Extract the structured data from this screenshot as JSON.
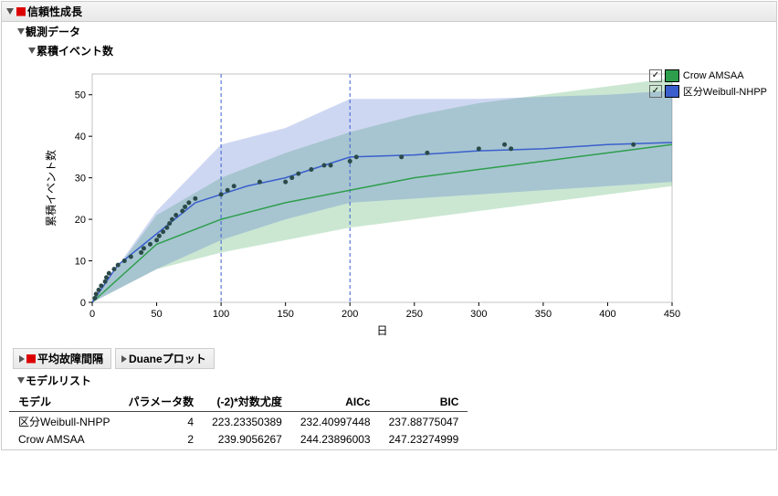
{
  "headers": {
    "main": "信頼性成長",
    "obs": "観測データ",
    "cum": "累積イベント数",
    "mtbf": "平均故障間隔",
    "duane": "Duaneプロット",
    "modellist": "モデルリスト"
  },
  "axis": {
    "x": "日",
    "y": "累積イベント数"
  },
  "legend": [
    {
      "label": "Crow AMSAA",
      "color": "#2e9e4d"
    },
    {
      "label": "区分Weibull-NHPP",
      "color": "#3a5fcd"
    }
  ],
  "model_table": {
    "cols": [
      "モデル",
      "パラメータ数",
      "(-2)*対数尤度",
      "AICc",
      "BIC"
    ],
    "rows": [
      [
        "区分Weibull-NHPP",
        "4",
        "223.23350389",
        "232.40997448",
        "237.88775047"
      ],
      [
        "Crow AMSAA",
        "2",
        "239.9056267",
        "244.23896003",
        "247.23274999"
      ]
    ]
  },
  "chart_data": {
    "type": "scatter+line+band",
    "title": "累積イベント数",
    "xlabel": "日",
    "ylabel": "累積イベント数",
    "xlim": [
      0,
      450
    ],
    "ylim": [
      0,
      55
    ],
    "xticks": [
      0,
      50,
      100,
      150,
      200,
      250,
      300,
      350,
      400,
      450
    ],
    "yticks": [
      0,
      10,
      20,
      30,
      40,
      50
    ],
    "vlines": [
      100,
      200
    ],
    "points": [
      [
        2,
        1
      ],
      [
        3,
        2
      ],
      [
        5,
        3
      ],
      [
        7,
        4
      ],
      [
        10,
        5
      ],
      [
        11,
        6
      ],
      [
        13,
        7
      ],
      [
        17,
        8
      ],
      [
        20,
        9
      ],
      [
        25,
        10
      ],
      [
        30,
        11
      ],
      [
        38,
        12
      ],
      [
        40,
        13
      ],
      [
        45,
        14
      ],
      [
        50,
        15
      ],
      [
        52,
        16
      ],
      [
        55,
        17
      ],
      [
        58,
        18
      ],
      [
        60,
        19
      ],
      [
        62,
        20
      ],
      [
        65,
        21
      ],
      [
        70,
        22
      ],
      [
        72,
        23
      ],
      [
        75,
        24
      ],
      [
        80,
        25
      ],
      [
        100,
        26
      ],
      [
        105,
        27
      ],
      [
        110,
        28
      ],
      [
        130,
        29
      ],
      [
        150,
        29
      ],
      [
        155,
        30
      ],
      [
        160,
        31
      ],
      [
        170,
        32
      ],
      [
        180,
        33
      ],
      [
        185,
        33
      ],
      [
        200,
        34
      ],
      [
        205,
        35
      ],
      [
        240,
        35
      ],
      [
        260,
        36
      ],
      [
        300,
        37
      ],
      [
        320,
        38
      ],
      [
        325,
        37
      ],
      [
        420,
        38
      ]
    ],
    "series": [
      {
        "name": "Crow AMSAA",
        "color": "#2e9e4d",
        "line": [
          [
            0,
            0
          ],
          [
            50,
            14
          ],
          [
            100,
            20
          ],
          [
            150,
            24
          ],
          [
            200,
            27
          ],
          [
            250,
            30
          ],
          [
            300,
            32
          ],
          [
            350,
            34
          ],
          [
            400,
            36
          ],
          [
            450,
            38
          ]
        ],
        "band_upper": [
          [
            0,
            0
          ],
          [
            50,
            21
          ],
          [
            100,
            30
          ],
          [
            150,
            36
          ],
          [
            200,
            41
          ],
          [
            250,
            45
          ],
          [
            300,
            48
          ],
          [
            350,
            50
          ],
          [
            400,
            52
          ],
          [
            450,
            54
          ]
        ],
        "band_lower": [
          [
            0,
            0
          ],
          [
            50,
            8
          ],
          [
            100,
            12
          ],
          [
            150,
            15
          ],
          [
            200,
            18
          ],
          [
            250,
            20
          ],
          [
            300,
            22
          ],
          [
            350,
            24
          ],
          [
            400,
            26
          ],
          [
            450,
            28
          ]
        ]
      },
      {
        "name": "区分Weibull-NHPP",
        "color": "#3a5fcd",
        "line": [
          [
            0,
            0
          ],
          [
            20,
            9
          ],
          [
            40,
            14
          ],
          [
            60,
            19
          ],
          [
            80,
            24
          ],
          [
            100,
            26
          ],
          [
            120,
            28
          ],
          [
            150,
            30
          ],
          [
            180,
            33
          ],
          [
            200,
            35
          ],
          [
            250,
            35.5
          ],
          [
            300,
            36.5
          ],
          [
            350,
            37
          ],
          [
            400,
            38
          ],
          [
            450,
            38.5
          ]
        ],
        "band_upper": [
          [
            0,
            0
          ],
          [
            50,
            22
          ],
          [
            100,
            38
          ],
          [
            150,
            42
          ],
          [
            200,
            49
          ],
          [
            250,
            49
          ],
          [
            300,
            49
          ],
          [
            350,
            49.5
          ],
          [
            400,
            50
          ],
          [
            450,
            51
          ]
        ],
        "band_lower": [
          [
            0,
            0
          ],
          [
            50,
            8
          ],
          [
            100,
            15
          ],
          [
            150,
            20
          ],
          [
            200,
            24
          ],
          [
            250,
            25
          ],
          [
            300,
            26
          ],
          [
            350,
            27
          ],
          [
            400,
            28
          ],
          [
            450,
            29
          ]
        ]
      }
    ]
  }
}
